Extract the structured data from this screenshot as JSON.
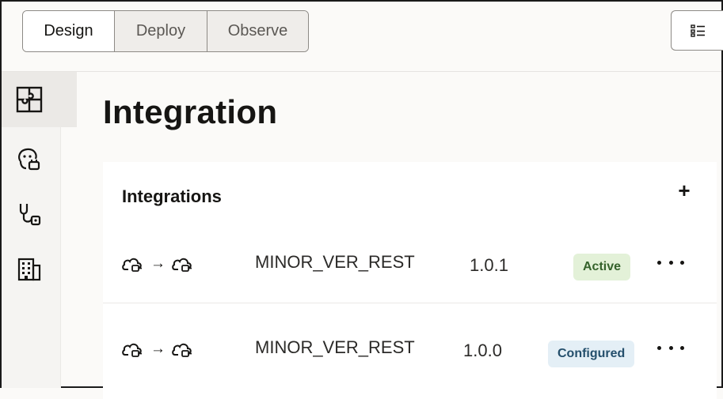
{
  "top_tabs": [
    {
      "label": "Design"
    },
    {
      "label": "Deploy"
    },
    {
      "label": "Observe"
    }
  ],
  "top_right": {
    "icon": "list-icon"
  },
  "rail": [
    {
      "icon": "puzzle-icon",
      "active": true
    },
    {
      "icon": "agent-plug-icon"
    },
    {
      "icon": "stethoscope-icon"
    },
    {
      "icon": "building-icon"
    }
  ],
  "page": {
    "title": "Integration"
  },
  "integrations": {
    "title": "Integrations",
    "add_label": "+",
    "rows": [
      {
        "name": "MINOR_VER_REST",
        "version": "1.0.1",
        "status": "Active"
      },
      {
        "name": "MINOR_VER_REST",
        "version": "1.0.0",
        "status": "Configured"
      }
    ]
  },
  "colors": {
    "accent_active_bg": "#e3f1d8",
    "accent_active_text": "#35622b",
    "accent_configured_bg": "#e4eff6",
    "accent_configured_text": "#244f6c"
  }
}
